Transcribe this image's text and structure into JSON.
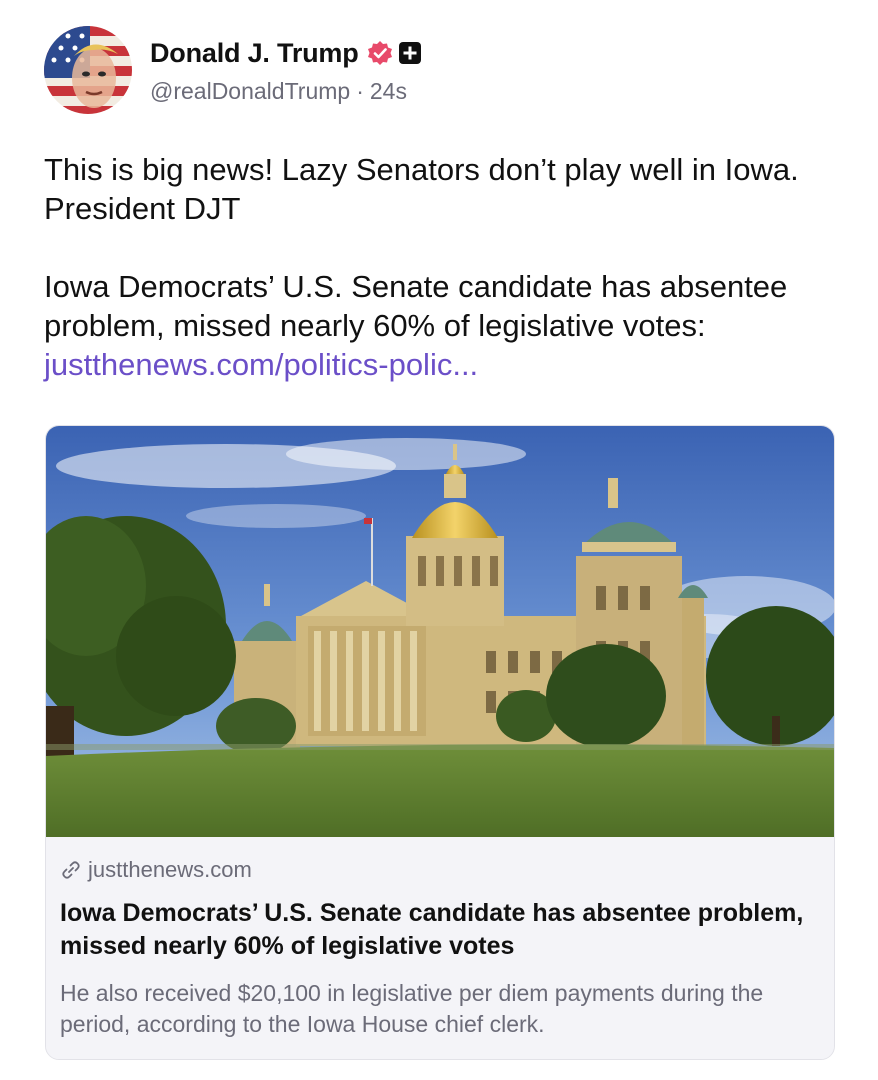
{
  "post": {
    "author": {
      "display_name": "Donald J. Trump",
      "handle": "@realDonaldTrump",
      "time_ago": "24s",
      "meta_separator": "·",
      "verified_badge_icon": "verified-icon",
      "plus_badge_icon": "plus-square-icon"
    },
    "text": {
      "line_1": "This is big news! Lazy Senators don’t play well in Iowa. President DJT",
      "line_2_prefix": "Iowa Democrats’ U.S. Senate candidate has absentee problem, missed nearly 60% of legislative votes: ",
      "line_2_link": "justthenews.com/politics-polic..."
    },
    "link_card": {
      "image_subject": "Iowa State Capitol building",
      "domain": "justthenews.com",
      "domain_icon": "link-icon",
      "title": "Iowa Democrats’ U.S. Senate candidate has absentee problem, missed nearly 60% of legislative votes",
      "description": "He also received $20,100 in legislative per diem payments during the period, according to the Iowa House chief clerk."
    }
  },
  "colors": {
    "link": "#6b4fc8",
    "verified_badge": "#e84a6a",
    "secondary_text": "#6b6b78",
    "card_background": "#f4f4f8"
  }
}
